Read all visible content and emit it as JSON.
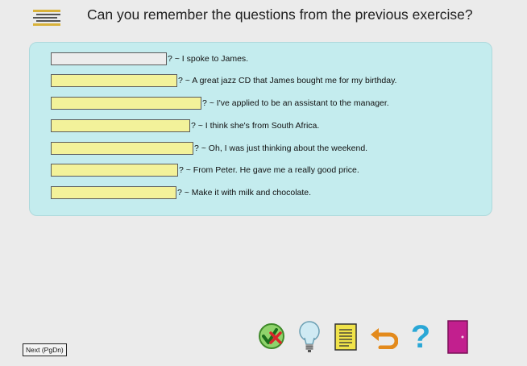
{
  "header": {
    "title": "Can you remember the questions from the previous exercise?",
    "menu_icon": "menu-lines-icon"
  },
  "exercise": {
    "items": [
      {
        "value": "",
        "answer": "? ~ I spoke to James."
      },
      {
        "value": "",
        "answer": "? ~ A great jazz CD that James bought me for my birthday."
      },
      {
        "value": "",
        "answer": "? ~ I've applied to be an assistant to the manager."
      },
      {
        "value": "",
        "answer": "? ~ I think she's from South Africa."
      },
      {
        "value": "",
        "answer": "? ~ Oh, I was just thinking about the weekend."
      },
      {
        "value": "",
        "answer": "? ~ From Peter. He gave me a really good price."
      },
      {
        "value": "",
        "answer": "? ~ Make it with milk and chocolate."
      }
    ]
  },
  "footer": {
    "next_label": "Next (PgDn)"
  },
  "toolbar": {
    "icons": [
      "check-answers-icon",
      "hint-lightbulb-icon",
      "notes-icon",
      "undo-icon",
      "help-icon",
      "exit-door-icon"
    ]
  },
  "colors": {
    "panel": "#c4ecee",
    "field": "#f3f29a",
    "active_field": "#ececec",
    "help": "#2aa7d6",
    "exit": "#c21f8e"
  }
}
